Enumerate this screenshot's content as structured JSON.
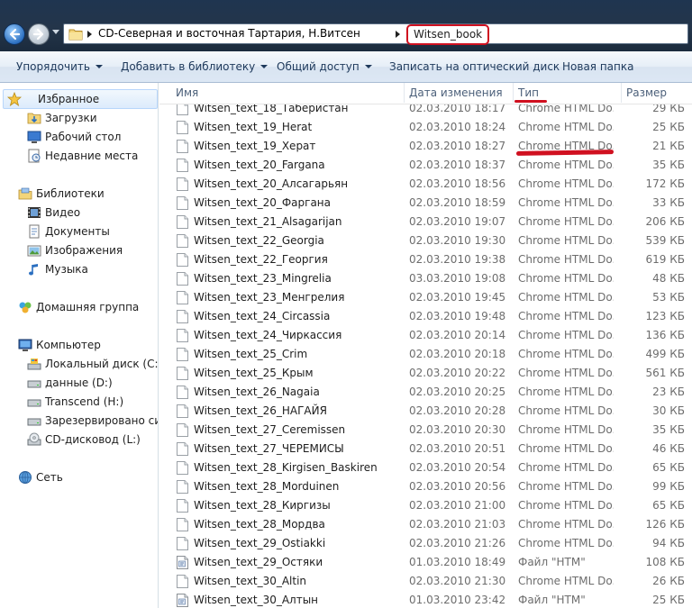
{
  "address": {
    "segments": [
      "CD-Северная и восточная Тартария, Н.Витсен"
    ],
    "current": "Witsen_book"
  },
  "toolbar": {
    "organize": "Упорядочить",
    "add_to_library": "Добавить в библиотеку",
    "share": "Общий доступ",
    "burn": "Записать на оптический диск",
    "new_folder": "Новая папка"
  },
  "nav": {
    "favorites": "Избранное",
    "downloads": "Загрузки",
    "desktop": "Рабочий стол",
    "recent": "Недавние места",
    "libraries": "Библиотеки",
    "video": "Видео",
    "documents": "Документы",
    "pictures": "Изображения",
    "music": "Музыка",
    "homegroup": "Домашняя группа",
    "computer": "Компьютер",
    "local_disk": "Локальный диск (C:)",
    "data_disk": "данные (D:)",
    "transcend": "Transcend (H:)",
    "reserved": "Зарезервировано сист",
    "cd_drive": "CD-дисковод (L:)",
    "network": "Сеть"
  },
  "columns": {
    "name": "Имя",
    "date": "Дата изменения",
    "type": "Тип",
    "size": "Размер"
  },
  "files": [
    {
      "name": "Witsen_text_18_Таберистан",
      "date": "02.03.2010 18:17",
      "type": "Chrome HTML Do...",
      "size": "29 КБ",
      "icon": "chrome"
    },
    {
      "name": "Witsen_text_19_Herat",
      "date": "02.03.2010 18:24",
      "type": "Chrome HTML Do...",
      "size": "25 КБ",
      "icon": "chrome"
    },
    {
      "name": "Witsen_text_19_Херат",
      "date": "02.03.2010 18:27",
      "type": "Chrome HTML Do...",
      "size": "21 КБ",
      "icon": "chrome"
    },
    {
      "name": "Witsen_text_20_Fargana",
      "date": "02.03.2010 18:37",
      "type": "Chrome HTML Do...",
      "size": "35 КБ",
      "icon": "chrome"
    },
    {
      "name": "Witsen_text_20_Алсагарьян",
      "date": "02.03.2010 18:56",
      "type": "Chrome HTML Do...",
      "size": "172 КБ",
      "icon": "chrome"
    },
    {
      "name": "Witsen_text_20_Фаргана",
      "date": "02.03.2010 18:59",
      "type": "Chrome HTML Do...",
      "size": "33 КБ",
      "icon": "chrome"
    },
    {
      "name": "Witsen_text_21_Alsagarijan",
      "date": "02.03.2010 19:07",
      "type": "Chrome HTML Do...",
      "size": "206 КБ",
      "icon": "chrome"
    },
    {
      "name": "Witsen_text_22_Georgia",
      "date": "02.03.2010 19:30",
      "type": "Chrome HTML Do...",
      "size": "539 КБ",
      "icon": "chrome"
    },
    {
      "name": "Witsen_text_22_Георгия",
      "date": "02.03.2010 19:38",
      "type": "Chrome HTML Do...",
      "size": "619 КБ",
      "icon": "chrome"
    },
    {
      "name": "Witsen_text_23_Mingrelia",
      "date": "03.03.2010 19:08",
      "type": "Chrome HTML Do...",
      "size": "48 КБ",
      "icon": "chrome"
    },
    {
      "name": "Witsen_text_23_Менгрелия",
      "date": "02.03.2010 19:45",
      "type": "Chrome HTML Do...",
      "size": "53 КБ",
      "icon": "chrome"
    },
    {
      "name": "Witsen_text_24_Circassia",
      "date": "02.03.2010 19:48",
      "type": "Chrome HTML Do...",
      "size": "123 КБ",
      "icon": "chrome"
    },
    {
      "name": "Witsen_text_24_Чиркассия",
      "date": "02.03.2010 20:14",
      "type": "Chrome HTML Do...",
      "size": "136 КБ",
      "icon": "chrome"
    },
    {
      "name": "Witsen_text_25_Crim",
      "date": "02.03.2010 20:18",
      "type": "Chrome HTML Do...",
      "size": "499 КБ",
      "icon": "chrome"
    },
    {
      "name": "Witsen_text_25_Крым",
      "date": "02.03.2010 20:22",
      "type": "Chrome HTML Do...",
      "size": "561 КБ",
      "icon": "chrome"
    },
    {
      "name": "Witsen_text_26_Nagaia",
      "date": "02.03.2010 20:25",
      "type": "Chrome HTML Do...",
      "size": "23 КБ",
      "icon": "chrome"
    },
    {
      "name": "Witsen_text_26_НАГАЙЯ",
      "date": "02.03.2010 20:28",
      "type": "Chrome HTML Do...",
      "size": "30 КБ",
      "icon": "chrome"
    },
    {
      "name": "Witsen_text_27_Ceremissen",
      "date": "02.03.2010 20:30",
      "type": "Chrome HTML Do...",
      "size": "35 КБ",
      "icon": "chrome"
    },
    {
      "name": "Witsen_text_27_ЧЕРЕМИСЫ",
      "date": "02.03.2010 20:51",
      "type": "Chrome HTML Do...",
      "size": "46 КБ",
      "icon": "chrome"
    },
    {
      "name": "Witsen_text_28_Kirgisen_Baskiren",
      "date": "02.03.2010 20:54",
      "type": "Chrome HTML Do...",
      "size": "65 КБ",
      "icon": "chrome"
    },
    {
      "name": "Witsen_text_28_Morduinen",
      "date": "02.03.2010 20:56",
      "type": "Chrome HTML Do...",
      "size": "99 КБ",
      "icon": "chrome"
    },
    {
      "name": "Witsen_text_28_Киргизы",
      "date": "02.03.2010 21:00",
      "type": "Chrome HTML Do...",
      "size": "65 КБ",
      "icon": "chrome"
    },
    {
      "name": "Witsen_text_28_Мордва",
      "date": "02.03.2010 21:03",
      "type": "Chrome HTML Do...",
      "size": "126 КБ",
      "icon": "chrome"
    },
    {
      "name": "Witsen_text_29_Ostiakki",
      "date": "02.03.2010 21:26",
      "type": "Chrome HTML Do...",
      "size": "94 КБ",
      "icon": "chrome"
    },
    {
      "name": "Witsen_text_29_Остяки",
      "date": "01.03.2010 18:49",
      "type": "Файл \"HTM\"",
      "size": "108 КБ",
      "icon": "htm"
    },
    {
      "name": "Witsen_text_30_Altin",
      "date": "02.03.2010 21:30",
      "type": "Chrome HTML Do...",
      "size": "26 КБ",
      "icon": "chrome"
    },
    {
      "name": "Witsen_text_30_Алтын",
      "date": "01.03.2010 23:42",
      "type": "Файл \"HTM\"",
      "size": "25 КБ",
      "icon": "htm"
    }
  ]
}
